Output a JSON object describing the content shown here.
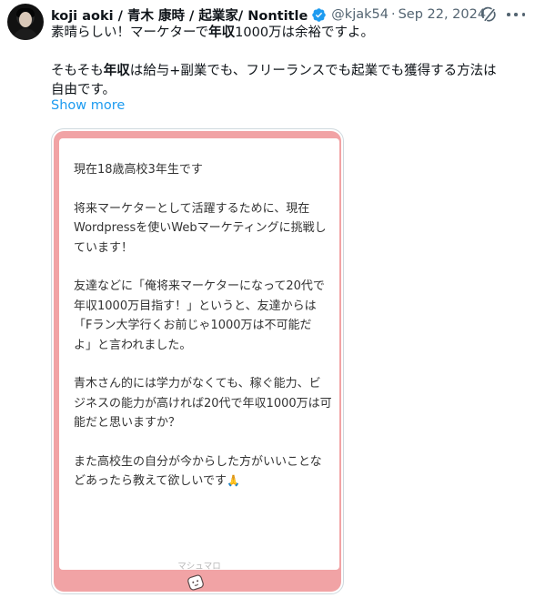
{
  "author": {
    "display_name": "koji aoki / 青木 康時 / 起業家/ Nontitle",
    "handle": "@kjak54",
    "separator": "·",
    "date": "Sep 22, 2024",
    "verified": true
  },
  "tweet": {
    "line1_pre": "素晴らしい！マーケターで",
    "line1_bold": "年収",
    "line1_post": "1000万は余裕ですよ。",
    "line2_pre": "そもそも",
    "line2_bold": "年収",
    "line2_post": "は給与+副業でも、フリーランスでも起業でも獲得する方法は",
    "line3": "自由です。",
    "show_more": "Show more"
  },
  "card": {
    "lines": [
      "現在18歳高校3年生です",
      "",
      "将来マーケターとして活躍するために、現在",
      "Wordpressを使いWebマーケティングに挑戦し",
      "ています！",
      "",
      "友達などに「俺将来マーケターになって20代で",
      "年収1000万目指す！」というと、友達からは",
      "「Fラン大学行くお前じゃ1000万は不可能だ",
      "よ」と言われました。",
      "",
      "青木さん的には学力がなくても、稼ぐ能力、ビ",
      "ジネスの能力が高ければ20代で年収1000万は可",
      "能だと思いますか？",
      "",
      "また高校生の自分が今からした方がいいことな",
      "どあったら教えて欲しいです"
    ],
    "emoji": "🙏",
    "watermark": "マシュマロ",
    "frame_color": "#f1a3a5"
  },
  "icons": {
    "verified": "verified-badge-icon",
    "grok": "grok-icon",
    "more": "more-options-icon",
    "logo": "marshmallow-logo-icon"
  },
  "colors": {
    "accent": "#1d9bf0",
    "muted": "#536471",
    "text": "#0f1419"
  }
}
